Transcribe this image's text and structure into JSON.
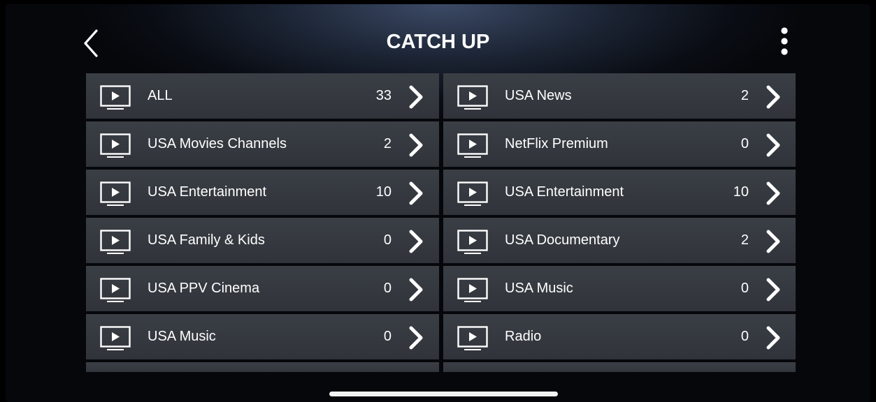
{
  "header": {
    "title": "CATCH UP",
    "back_icon": "chevron-left-icon",
    "more_icon": "more-vertical-icon"
  },
  "categories": {
    "left": [
      {
        "label": "ALL",
        "count": "33"
      },
      {
        "label": "USA Movies Channels",
        "count": "2"
      },
      {
        "label": "USA Entertainment",
        "count": "10"
      },
      {
        "label": "USA Family & Kids",
        "count": "0"
      },
      {
        "label": "USA PPV Cinema",
        "count": "0"
      },
      {
        "label": "USA Music",
        "count": "0"
      }
    ],
    "right": [
      {
        "label": "USA News",
        "count": "2"
      },
      {
        "label": "NetFlix Premium",
        "count": "0"
      },
      {
        "label": "USA Entertainment",
        "count": "10"
      },
      {
        "label": "USA Documentary",
        "count": "2"
      },
      {
        "label": "USA Music",
        "count": "0"
      },
      {
        "label": "Radio",
        "count": "0"
      }
    ]
  },
  "icons": {
    "row_icon": "tv-play-icon",
    "row_arrow": "chevron-right-icon"
  },
  "colors": {
    "row_bg": "#34383e",
    "text": "#ffffff",
    "background": "#05070b"
  }
}
